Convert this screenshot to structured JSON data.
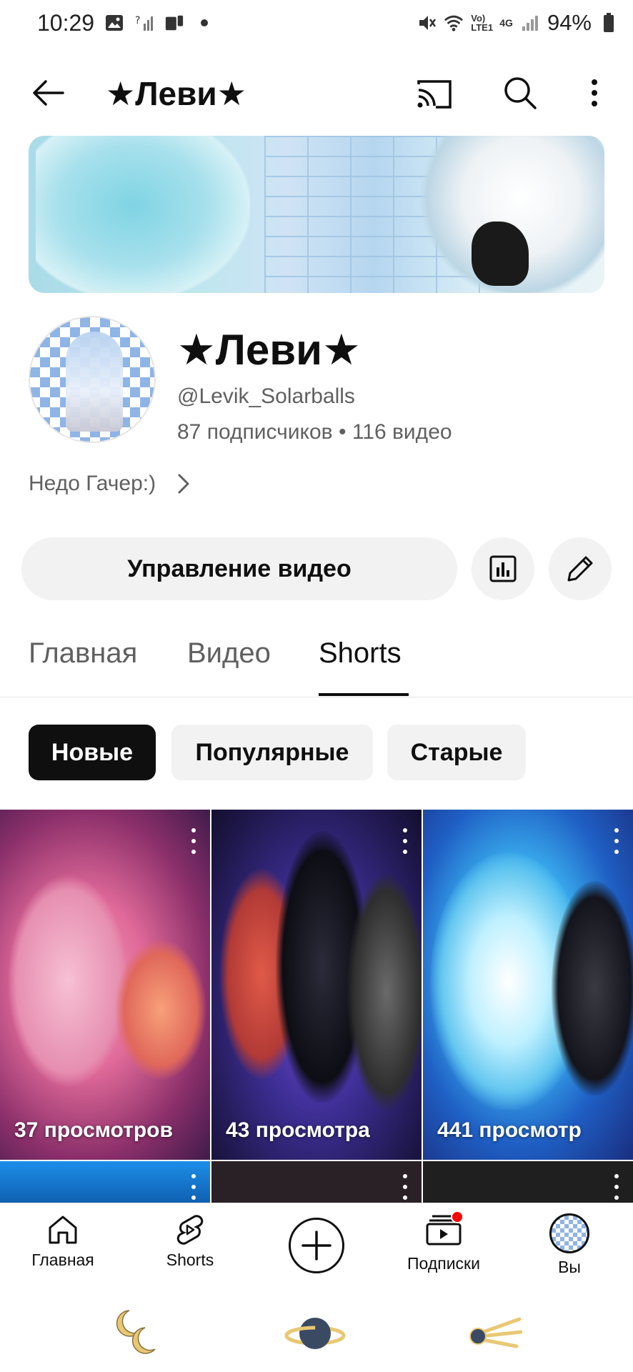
{
  "status_bar": {
    "time": "10:29",
    "battery": "94%",
    "network": "4G",
    "volte": "Vo) LTE1"
  },
  "app_bar": {
    "title": "★Леви★",
    "icons": [
      "arrow-back-icon",
      "cast-icon",
      "search-icon",
      "more-vert-icon"
    ]
  },
  "channel": {
    "name": "★Леви★",
    "handle": "@Levik_Solarballs",
    "subscribers": "87 подписчиков",
    "separator": "•",
    "videos": "116 видео",
    "description": "Недо Гачер:)"
  },
  "actions": {
    "manage_label": "Управление видео",
    "icons": [
      "analytics-icon",
      "edit-pencil-icon"
    ]
  },
  "tabs": [
    {
      "label": "Главная",
      "active": false
    },
    {
      "label": "Видео",
      "active": false
    },
    {
      "label": "Shorts",
      "active": true
    }
  ],
  "chips": [
    {
      "label": "Новые",
      "active": true
    },
    {
      "label": "Популярные",
      "active": false
    },
    {
      "label": "Старые",
      "active": false
    }
  ],
  "shorts": [
    {
      "views": "37 просмотров"
    },
    {
      "views": "43 просмотра"
    },
    {
      "views": "441 просмотр"
    },
    {
      "views": ""
    },
    {
      "views": ""
    },
    {
      "views": ""
    }
  ],
  "bottom_nav": [
    {
      "label": "Главная",
      "icon": "home-icon"
    },
    {
      "label": "Shorts",
      "icon": "shorts-icon"
    },
    {
      "label": "",
      "icon": "create-plus-icon"
    },
    {
      "label": "Подписки",
      "icon": "subscriptions-icon"
    },
    {
      "label": "Вы",
      "icon": "you-avatar-icon"
    }
  ],
  "system_nav": {
    "icons": [
      "moons-icon",
      "planet-icon",
      "comet-icon"
    ]
  },
  "colors": {
    "accent": "#0f0f0f",
    "secondary_text": "#606060",
    "chip_bg": "#f2f2f2",
    "notification": "#ff0000"
  }
}
